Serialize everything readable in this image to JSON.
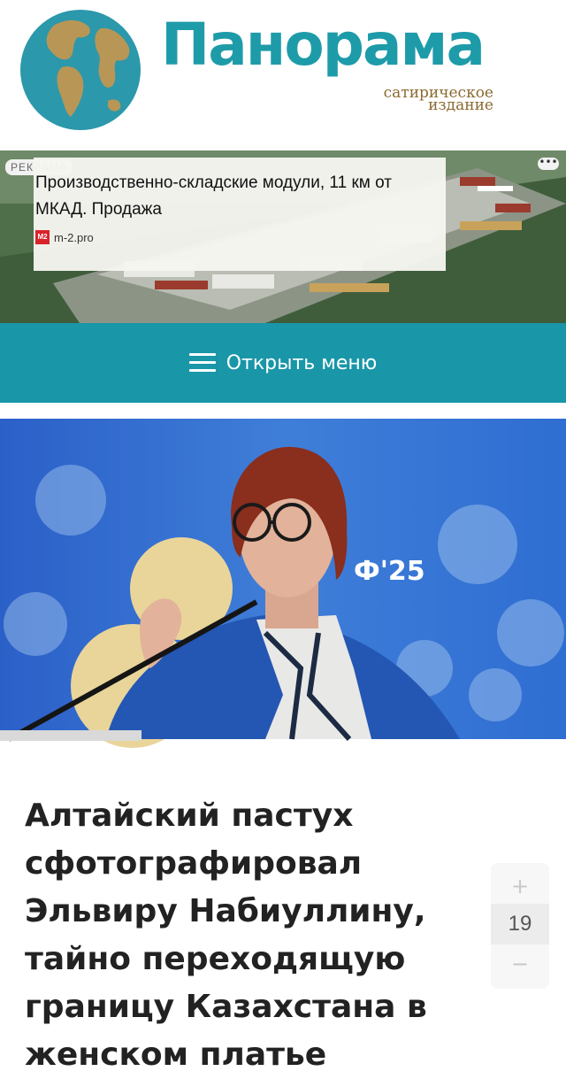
{
  "header": {
    "brand": "Панорама",
    "tagline_line1": "сатирическое",
    "tagline_line2": "издание",
    "logo_icon": "globe-icon"
  },
  "ad": {
    "badge": "РЕКЛАМА",
    "more_icon": "more-dots-icon",
    "title": "Производственно-складские модули, 11 км от МКАД. Продажа",
    "source_logo": "М2",
    "source": "m-2.pro"
  },
  "menu": {
    "icon": "hamburger-icon",
    "label": "Открыть меню",
    "color": "#1996a8"
  },
  "article": {
    "title": "Алтайский пастух сфотографировал Эльвиру Набиуллину, тайно переходящую границу Казахстана в женском платье",
    "vote_up": "+",
    "vote_count": "19",
    "vote_down": "−"
  },
  "colors": {
    "brand": "#1e9ba9",
    "tagline": "#8a6a30"
  }
}
